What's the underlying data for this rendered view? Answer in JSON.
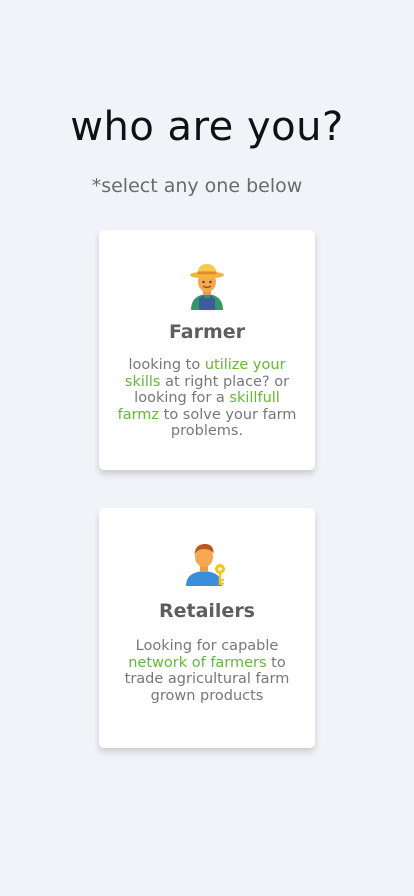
{
  "header": {
    "title": "who are you?",
    "subtitle": "*select any one below"
  },
  "cards": [
    {
      "title": "Farmer",
      "icon": "farmer-icon",
      "description": {
        "p1": "looking to ",
        "h1": "utilize your skills",
        "p2": " at right place? or looking for a ",
        "h2": "skillfull farmz",
        "p3": " to solve your farm problems."
      }
    },
    {
      "title": "Retailers",
      "icon": "retailer-icon",
      "description": {
        "p1": "Looking for capable ",
        "h1": "network of farmers",
        "p2": " to trade agricultural farm grown products"
      }
    }
  ],
  "colors": {
    "background": "#f1f3f8",
    "highlight": "#62b935",
    "title_text": "#5e5e5e"
  }
}
